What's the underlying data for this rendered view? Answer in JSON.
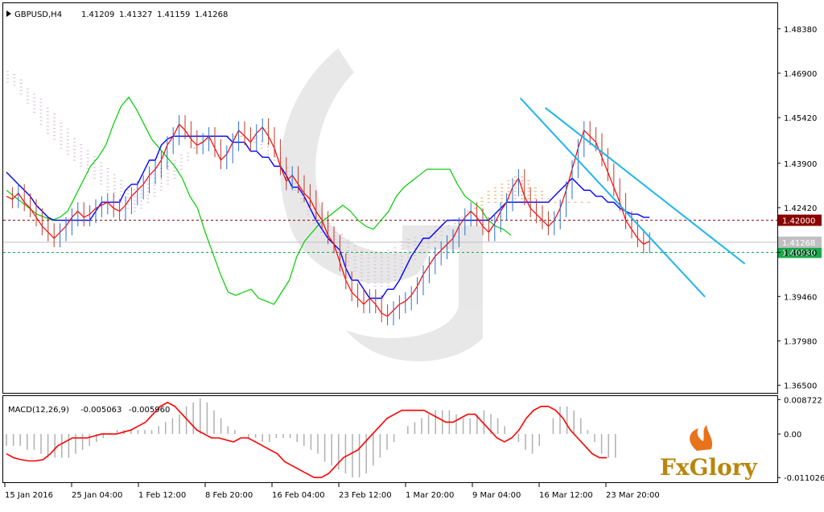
{
  "chart_data": {
    "type": "line",
    "symbol": "GBPUSD,H4",
    "ohlc": [
      "1.41209",
      "1.41327",
      "1.41159",
      "1.41268"
    ],
    "price_axis": {
      "ylim": [
        1.36248,
        1.49232
      ],
      "ticks": [
        "1.48380",
        "1.46900",
        "1.45420",
        "1.43900",
        "1.42420",
        "1.40930",
        "1.39460",
        "1.37980",
        "1.36500"
      ]
    },
    "levels": [
      {
        "label": "1.42000",
        "value": 1.42,
        "color": "#8b0000",
        "style": "dotted"
      },
      {
        "label": "1.40930",
        "value": 1.4093,
        "color": "#1aa84a",
        "style": "dotted"
      },
      {
        "label": "1.41268",
        "value": 1.41268,
        "color": "#c0c0c0",
        "style": "solid"
      }
    ],
    "time_axis": {
      "ticks": [
        "15 Jan 2016",
        "25 Jan 04:00",
        "1 Feb 12:00",
        "8 Feb 20:00",
        "16 Feb 04:00",
        "23 Feb 12:00",
        "1 Mar 20:00",
        "9 Mar 04:00",
        "16 Mar 12:00",
        "23 Mar 20:00"
      ]
    },
    "price_series": {
      "close": [
        1.428,
        1.427,
        1.429,
        1.426,
        1.424,
        1.421,
        1.418,
        1.416,
        1.414,
        1.416,
        1.418,
        1.421,
        1.423,
        1.421,
        1.422,
        1.424,
        1.425,
        1.426,
        1.424,
        1.423,
        1.425,
        1.428,
        1.43,
        1.432,
        1.435,
        1.437,
        1.44,
        1.445,
        1.448,
        1.452,
        1.45,
        1.447,
        1.445,
        1.446,
        1.448,
        1.444,
        1.44,
        1.442,
        1.446,
        1.45,
        1.448,
        1.446,
        1.449,
        1.451,
        1.448,
        1.444,
        1.438,
        1.433,
        1.435,
        1.432,
        1.429,
        1.427,
        1.423,
        1.42,
        1.415,
        1.412,
        1.406,
        1.4,
        1.396,
        1.394,
        1.392,
        1.394,
        1.392,
        1.389,
        1.388,
        1.39,
        1.392,
        1.393,
        1.395,
        1.398,
        1.402,
        1.405,
        1.408,
        1.41,
        1.412,
        1.414,
        1.418,
        1.421,
        1.423,
        1.421,
        1.418,
        1.416,
        1.419,
        1.423,
        1.426,
        1.431,
        1.434,
        1.428,
        1.424,
        1.422,
        1.42,
        1.418,
        1.42,
        1.424,
        1.43,
        1.437,
        1.444,
        1.45,
        1.448,
        1.446,
        1.441,
        1.436,
        1.431,
        1.426,
        1.42,
        1.417,
        1.414,
        1.412,
        1.413
      ],
      "kijun": [
        1.436,
        1.434,
        1.432,
        1.43,
        1.428,
        1.425,
        1.423,
        1.421,
        1.42,
        1.42,
        1.42,
        1.42,
        1.42,
        1.42,
        1.42,
        1.423,
        1.426,
        1.426,
        1.426,
        1.426,
        1.43,
        1.432,
        1.432,
        1.436,
        1.44,
        1.44,
        1.445,
        1.447,
        1.448,
        1.448,
        1.448,
        1.448,
        1.448,
        1.448,
        1.448,
        1.448,
        1.448,
        1.448,
        1.446,
        1.446,
        1.446,
        1.443,
        1.443,
        1.441,
        1.441,
        1.438,
        1.438,
        1.435,
        1.431,
        1.431,
        1.428,
        1.424,
        1.42,
        1.417,
        1.414,
        1.412,
        1.41,
        1.404,
        1.4,
        1.4,
        1.397,
        1.394,
        1.394,
        1.394,
        1.397,
        1.397,
        1.4,
        1.404,
        1.408,
        1.411,
        1.414,
        1.414,
        1.416,
        1.418,
        1.42,
        1.42,
        1.42,
        1.42,
        1.42,
        1.42,
        1.42,
        1.42,
        1.422,
        1.424,
        1.426,
        1.426,
        1.426,
        1.426,
        1.426,
        1.426,
        1.426,
        1.426,
        1.428,
        1.43,
        1.432,
        1.434,
        1.432,
        1.43,
        1.43,
        1.428,
        1.428,
        1.426,
        1.426,
        1.424,
        1.423,
        1.422,
        1.422,
        1.421,
        1.421
      ],
      "chikou": [
        1.43,
        1.428,
        1.426,
        1.424,
        1.422,
        1.421,
        1.42,
        1.421,
        1.423,
        1.428,
        1.433,
        1.438,
        1.441,
        1.445,
        1.452,
        1.458,
        1.461,
        1.457,
        1.452,
        1.447,
        1.444,
        1.441,
        1.438,
        1.434,
        1.428,
        1.424,
        1.416,
        1.409,
        1.402,
        1.396,
        1.395,
        1.396,
        1.397,
        1.394,
        1.393,
        1.392,
        1.396,
        1.4,
        1.408,
        1.413,
        1.416,
        1.419,
        1.421,
        1.423,
        1.425,
        1.423,
        1.42,
        1.418,
        1.417,
        1.42,
        1.423,
        1.428,
        1.431,
        1.433,
        1.435,
        1.437,
        1.437,
        1.437,
        1.437,
        1.432,
        1.428,
        1.426,
        1.424,
        1.42,
        1.418,
        1.417,
        1.415
      ]
    },
    "ichimoku_cloud": {
      "span_a": [
        1.466,
        1.465,
        1.462,
        1.459,
        1.456,
        1.452,
        1.449,
        1.447,
        1.444,
        1.442,
        1.44,
        1.438,
        1.436,
        1.434,
        1.432,
        1.43,
        1.428,
        1.426,
        1.424,
        1.423,
        1.424,
        1.426,
        1.428,
        1.43,
        1.432,
        1.434,
        1.437,
        1.44,
        1.444,
        1.446,
        1.447,
        1.448,
        1.448,
        1.448,
        1.448,
        1.448,
        1.447,
        1.446,
        1.444,
        1.442,
        1.44,
        1.437,
        1.434,
        1.43,
        1.426,
        1.422,
        1.419,
        1.416,
        1.413,
        1.41,
        1.408,
        1.405,
        1.403,
        1.4,
        1.399,
        1.398,
        1.398,
        1.398,
        1.4,
        1.402,
        1.404,
        1.407,
        1.409,
        1.411,
        1.413,
        1.415,
        1.417,
        1.419,
        1.421,
        1.423,
        1.425,
        1.428,
        1.43,
        1.432,
        1.433,
        1.434,
        1.435,
        1.435,
        1.434,
        1.432,
        1.43,
        1.428,
        1.427,
        1.427,
        1.426,
        1.426,
        1.426,
        1.426
      ],
      "span_b": [
        1.47,
        1.469,
        1.467,
        1.465,
        1.463,
        1.461,
        1.458,
        1.456,
        1.453,
        1.451,
        1.448,
        1.446,
        1.444,
        1.442,
        1.44,
        1.438,
        1.436,
        1.434,
        1.432,
        1.431,
        1.432,
        1.434,
        1.436,
        1.438,
        1.44,
        1.441,
        1.442,
        1.443,
        1.444,
        1.446,
        1.447,
        1.448,
        1.448,
        1.448,
        1.448,
        1.448,
        1.448,
        1.448,
        1.447,
        1.446,
        1.444,
        1.441,
        1.438,
        1.434,
        1.43,
        1.426,
        1.424,
        1.422,
        1.42,
        1.418,
        1.416,
        1.414,
        1.412,
        1.41,
        1.409,
        1.409,
        1.41,
        1.411,
        1.412,
        1.413,
        1.414,
        1.415,
        1.416,
        1.417,
        1.418,
        1.419,
        1.42,
        1.421,
        1.422,
        1.423,
        1.424,
        1.425,
        1.426,
        1.426,
        1.426,
        1.426,
        1.426,
        1.426,
        1.426,
        1.426,
        1.426,
        1.426,
        1.426,
        1.426,
        1.426,
        1.426,
        1.426,
        1.426
      ]
    },
    "trend_channel": {
      "color": "#1eb4f0",
      "upper": [
        {
          "x": 108,
          "y": 1.4575
        },
        {
          "x": 148,
          "y": 1.4055
        }
      ],
      "lower": [
        {
          "x": 103,
          "y": 1.4607
        },
        {
          "x": 140,
          "y": 1.3945
        }
      ]
    },
    "macd": {
      "label": "MACD(12,26,9)",
      "main": "-0.005063",
      "signal": "-0.005960",
      "ylim": [
        -0.0122,
        0.0096
      ],
      "ticks": [
        "0.008722",
        "0.00",
        "-0.011026"
      ],
      "histogram": [
        -0.003,
        -0.003,
        -0.003,
        -0.004,
        -0.004,
        -0.005,
        -0.006,
        -0.006,
        -0.006,
        -0.006,
        -0.005,
        -0.004,
        -0.003,
        -0.002,
        -0.001,
        0.0,
        0.001,
        0.001,
        0.001,
        0.001,
        0.001,
        0.001,
        0.002,
        0.003,
        0.004,
        0.005,
        0.007,
        0.008,
        0.009,
        0.008,
        0.006,
        0.004,
        0.002,
        0.001,
        0.0,
        -0.001,
        -0.001,
        -0.002,
        -0.002,
        -0.001,
        -0.001,
        -0.001,
        -0.002,
        -0.003,
        -0.004,
        -0.005,
        -0.007,
        -0.008,
        -0.009,
        -0.01,
        -0.011,
        -0.011,
        -0.01,
        -0.008,
        -0.006,
        -0.004,
        -0.002,
        0.0,
        0.002,
        0.003,
        0.004,
        0.005,
        0.006,
        0.006,
        0.006,
        0.005,
        0.004,
        0.004,
        0.005,
        0.006,
        0.005,
        0.004,
        0.002,
        0.0,
        -0.002,
        -0.004,
        -0.005,
        -0.003,
        0.0,
        0.004,
        0.007,
        0.007,
        0.006,
        0.004,
        0.001,
        -0.002,
        -0.005,
        -0.006,
        -0.006
      ],
      "signal_series": [
        -0.005,
        -0.006,
        -0.0065,
        -0.0068,
        -0.0068,
        -0.0065,
        -0.005,
        -0.003,
        -0.002,
        -0.001,
        -0.001,
        -0.001,
        -0.0005,
        0.0,
        0.0,
        0.0,
        0.0005,
        0.001,
        0.002,
        0.003,
        0.005,
        0.007,
        0.008,
        0.007,
        0.005,
        0.003,
        0.001,
        0.0,
        -0.001,
        -0.001,
        -0.0015,
        -0.002,
        -0.001,
        -0.001,
        -0.002,
        -0.003,
        -0.004,
        -0.005,
        -0.007,
        -0.008,
        -0.009,
        -0.01,
        -0.011,
        -0.011,
        -0.01,
        -0.008,
        -0.006,
        -0.005,
        -0.004,
        -0.002,
        0.0,
        0.002,
        0.004,
        0.005,
        0.006,
        0.006,
        0.006,
        0.006,
        0.005,
        0.004,
        0.003,
        0.003,
        0.004,
        0.005,
        0.005,
        0.003,
        0.001,
        -0.001,
        -0.002,
        -0.001,
        0.001,
        0.004,
        0.006,
        0.007,
        0.007,
        0.006,
        0.004,
        0.001,
        -0.001,
        -0.003,
        -0.005,
        -0.006,
        -0.006
      ]
    },
    "grid": false,
    "watermark": "FxGlory"
  },
  "colors": {
    "close": "#ff0000",
    "kijun": "#0000ff",
    "chikou": "#00cc00",
    "span_a": "#f4a460",
    "span_b": "#d8bfd8",
    "macd_hist": "#b0b0b0",
    "macd_signal": "#ff0000"
  },
  "logo": {
    "text": "FxGlory"
  }
}
